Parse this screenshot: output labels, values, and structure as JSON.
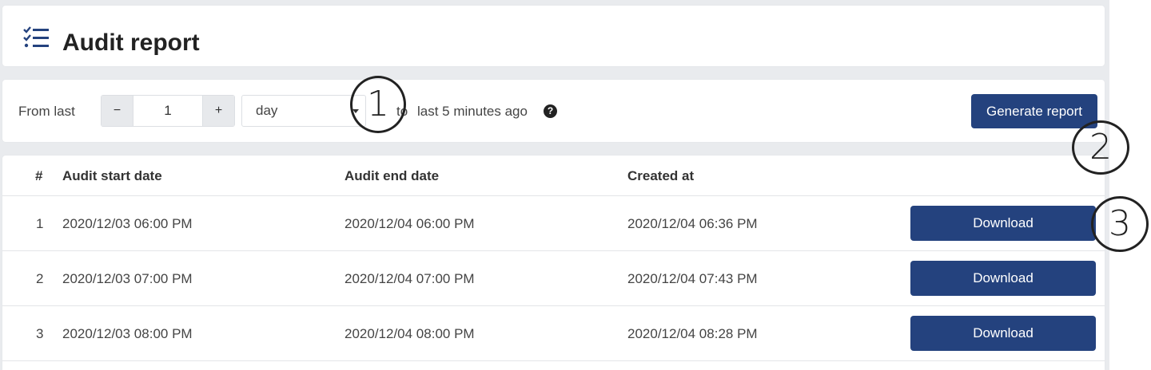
{
  "header": {
    "title": "Audit report",
    "icon": "checklist-icon"
  },
  "filter": {
    "from_label": "From last",
    "decrement_label": "−",
    "value": "1",
    "increment_label": "+",
    "unit": "day",
    "to_label": "to",
    "range_label": "last 5 minutes ago",
    "help_glyph": "?",
    "generate_label": "Generate report"
  },
  "table": {
    "columns": [
      "#",
      "Audit start date",
      "Audit end date",
      "Created at"
    ],
    "rows": [
      {
        "index": "1",
        "start": "2020/12/03 06:00 PM",
        "end": "2020/12/04 06:00 PM",
        "created": "2020/12/04 06:36 PM",
        "action": "Download"
      },
      {
        "index": "2",
        "start": "2020/12/03 07:00 PM",
        "end": "2020/12/04 07:00 PM",
        "created": "2020/12/04 07:43 PM",
        "action": "Download"
      },
      {
        "index": "3",
        "start": "2020/12/03 08:00 PM",
        "end": "2020/12/04 08:00 PM",
        "created": "2020/12/04 08:28 PM",
        "action": "Download"
      }
    ]
  },
  "annotations": [
    "1",
    "2",
    "3"
  ],
  "colors": {
    "primary": "#24427e",
    "background": "#e9ebee"
  }
}
